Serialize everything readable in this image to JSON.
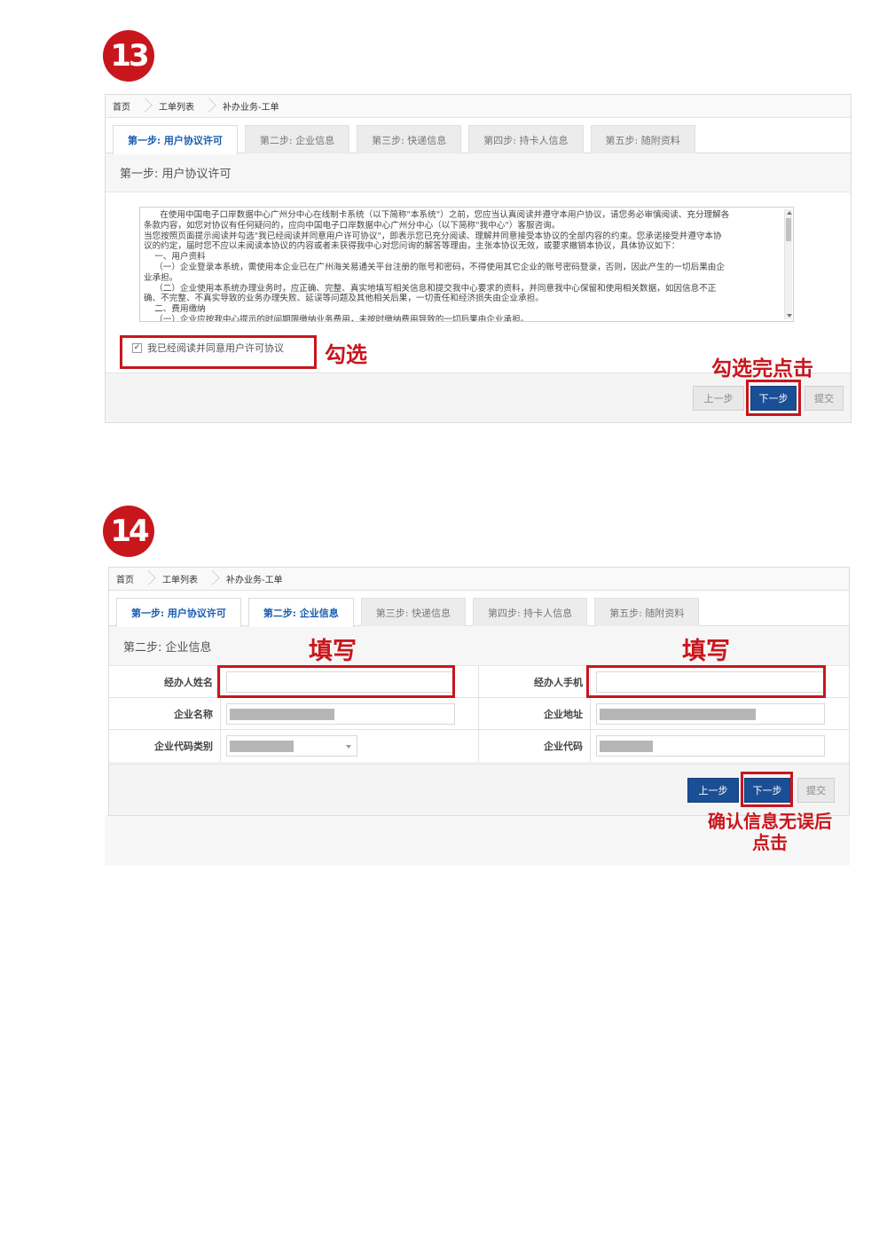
{
  "step13": {
    "badge": "13",
    "breadcrumb": [
      "首页",
      "工单列表",
      "补办业务-工单"
    ],
    "tabs": [
      "第一步: 用户协议许可",
      "第二步: 企业信息",
      "第三步: 快递信息",
      "第四步: 持卡人信息",
      "第五步: 随附资料"
    ],
    "active_tab": 0,
    "section_title": "第一步: 用户协议许可",
    "agreement_lines": [
      "      在使用中国电子口岸数据中心广州分中心在线制卡系统（以下简称\"本系统\"）之前，您应当认真阅读并遵守本用户协议，请您务必审慎阅读、充分理解各",
      "条款内容，如您对协议有任何疑问的，应向中国电子口岸数据中心广州分中心（以下简称\"我中心\"）客服咨询。",
      "当您按照页面提示阅读并勾选\"我已经阅读并同意用户许可协议\"，即表示您已充分阅读、理解并同意接受本协议的全部内容的约束。您承诺接受并遵守本协",
      "议的约定，届时您不应以未阅读本协议的内容或者未获得我中心对您问询的解答等理由，主张本协议无效，或要求撤销本协议，具体协议如下：",
      "    一、用户资料",
      "    （一）企业登录本系统，需使用本企业已在广州海关易通关平台注册的账号和密码，不得使用其它企业的账号密码登录，否则，因此产生的一切后果由企",
      "业承担。",
      "    （二）企业使用本系统办理业务时，应正确、完整、真实地填写相关信息和提交我中心要求的资料，并同意我中心保留和使用相关数据，如因信息不正",
      "确、不完整、不真实导致的业务办理失败、延误等问题及其他相关后果，一切责任和经济损失由企业承担。",
      "    二、费用缴纳",
      "    （一）企业应按我中心提示的时间期限缴纳业务费用，未按时缴纳费用导致的一切后果由企业承担。"
    ],
    "agree_label": "我已经阅读并同意用户许可协议",
    "agree_checked": "✓",
    "buttons": {
      "prev": "上一步",
      "next": "下一步",
      "submit": "提交"
    },
    "annotation_check": "勾选",
    "annotation_click": "勾选完点击"
  },
  "step14": {
    "badge": "14",
    "breadcrumb": [
      "首页",
      "工单列表",
      "补办业务-工单"
    ],
    "tabs": [
      "第一步: 用户协议许可",
      "第二步: 企业信息",
      "第三步: 快递信息",
      "第四步: 持卡人信息",
      "第五步: 随附资料"
    ],
    "active_tabs": [
      0,
      1
    ],
    "section_title": "第二步: 企业信息",
    "fields": {
      "handler_name": "经办人姓名",
      "handler_phone": "经办人手机",
      "company_name": "企业名称",
      "company_address": "企业地址",
      "code_type": "企业代码类别",
      "company_code": "企业代码"
    },
    "buttons": {
      "prev": "上一步",
      "next": "下一步",
      "submit": "提交"
    },
    "annotation_fill_left": "填写",
    "annotation_fill_right": "填写",
    "annotation_confirm_1": "确认信息无误后",
    "annotation_confirm_2": "点击"
  },
  "colors": {
    "accent_red": "#c8161d",
    "primary_blue": "#1a4f96",
    "active_tab_text": "#1a5db0"
  }
}
